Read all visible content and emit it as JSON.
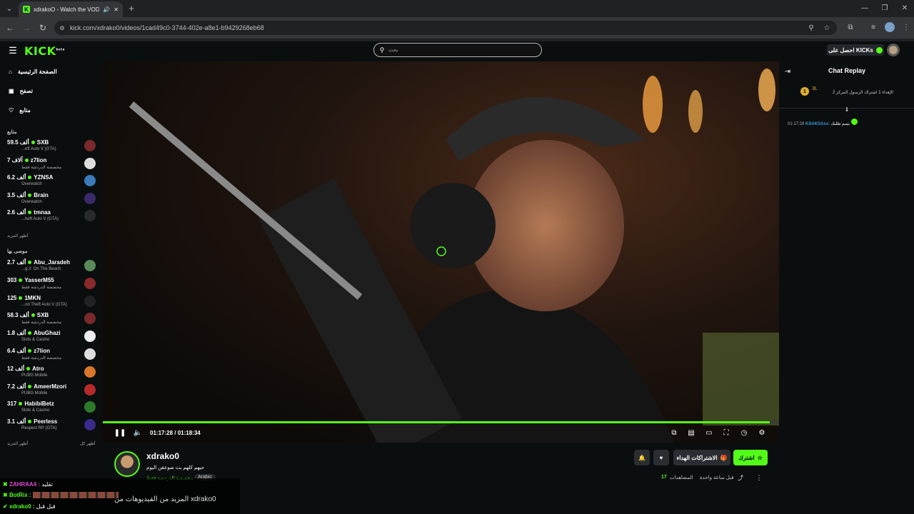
{
  "browser": {
    "tab_title": "xdrakoO - Watch the VOD o",
    "url": "kick.com/xdrako0/videos/1cad49c0-3744-402e-a8e1-b9429268eb68"
  },
  "topnav": {
    "logo": "KICK",
    "logo_sup": "beta",
    "search_placeholder": "بحث",
    "kicks_label": "احصل على KICKs"
  },
  "sidebar": {
    "nav": [
      {
        "label": "الصفحة الرئيسية",
        "icon": "home-icon"
      },
      {
        "label": "تصفح",
        "icon": "browse-icon"
      },
      {
        "label": "متابع",
        "icon": "heart-icon"
      }
    ],
    "following_header": "متابع",
    "following": [
      {
        "viewers": "59.5 ألف",
        "name": "SXB",
        "category": "...eft Auto V (GTA)",
        "color": "#7a2a2a"
      },
      {
        "viewers": "7 آلاف",
        "name": "z7lion",
        "category": "مخصصة الدردشة فقط",
        "color": "#dddddd"
      },
      {
        "viewers": "6.2 ألف",
        "name": "YZNSA",
        "category": "Overwatch",
        "color": "#3a7ab8"
      },
      {
        "viewers": "3.5 ألف",
        "name": "Brain",
        "category": "Overwatch",
        "color": "#3a2a6a"
      },
      {
        "viewers": "2.6 ألف",
        "name": "tmnaa",
        "category": "...heft Auto V (GTA)",
        "color": "#2a2a2a"
      }
    ],
    "show_more": "أظهر المزيد",
    "recommended_header": "موصى بها",
    "recommended": [
      {
        "viewers": "2.7 ألف",
        "name": "Abu_Jaradeh",
        "category": "...g 2: On The Beach",
        "color": "#5a8a5a"
      },
      {
        "viewers": "303",
        "name": "YasserM55",
        "category": "مخصصة الدردشة فقط",
        "color": "#8a2a2a"
      },
      {
        "viewers": "125",
        "name": "1MKN",
        "category": "...nd Theft Auto V (GTA)",
        "color": "#222222"
      },
      {
        "viewers": "58.3 ألف",
        "name": "SXB",
        "category": "مخصصة الدردشة فقط",
        "color": "#7a2a2a"
      },
      {
        "viewers": "1.8 ألف",
        "name": "AbuGhazi",
        "category": "Slots & Casino",
        "color": "#eeeeee"
      },
      {
        "viewers": "6.4 ألف",
        "name": "z7lion",
        "category": "مخصصة الدردشة فقط",
        "color": "#dddddd"
      },
      {
        "viewers": "12 ألف",
        "name": "Atro",
        "category": "PUBG Mobile",
        "color": "#d8762a"
      },
      {
        "viewers": "7.2 ألف",
        "name": "AmeerMzori",
        "category": "PUBG Mobile",
        "color": "#b82a2a"
      },
      {
        "viewers": "317",
        "name": "HabibiBetz",
        "category": "Slots & Casino",
        "color": "#2a7a2a"
      },
      {
        "viewers": "3.1 ألف",
        "name": "Peerless",
        "category": "Respect RP (GTA)",
        "color": "#3a2a8a"
      }
    ],
    "show_more_2": "أظهر المزيد",
    "show_all": "أظهر كل"
  },
  "player": {
    "time": "01:17:28 / 01:18:34",
    "progress": 0.986
  },
  "stream": {
    "channel": "xdrako0",
    "title": "حيهم كلهم بث صوعقن اليوم",
    "category": "مخصصة الدردشة فقط",
    "language": "Arabic",
    "subscribe": "اشترك",
    "gift": "الاشتراكات الهداء",
    "views_label": "المشاهدات",
    "views_count": "17",
    "time_ago": "قبل ساعة واحدة"
  },
  "chat": {
    "title": "Chat Replay",
    "pinned_text": "الإهداء 1 اشتراك الرسول المركز 2",
    "pinned_badge_num": "1",
    "pinned_badge_text": "3L",
    "message_time": "01:17:28",
    "message_user": "KSAKSAxx:",
    "message_text": "بسم طلبك"
  },
  "overlay_chat": [
    {
      "user": "ZAHRAA4 :",
      "text": "تقليد"
    },
    {
      "user": "BotRix :",
      "text": ""
    },
    {
      "user": "xdrako0 :",
      "text": "قبل قبل"
    }
  ],
  "overlay_more": "المزيد من الفيديوهات من xdrako0"
}
